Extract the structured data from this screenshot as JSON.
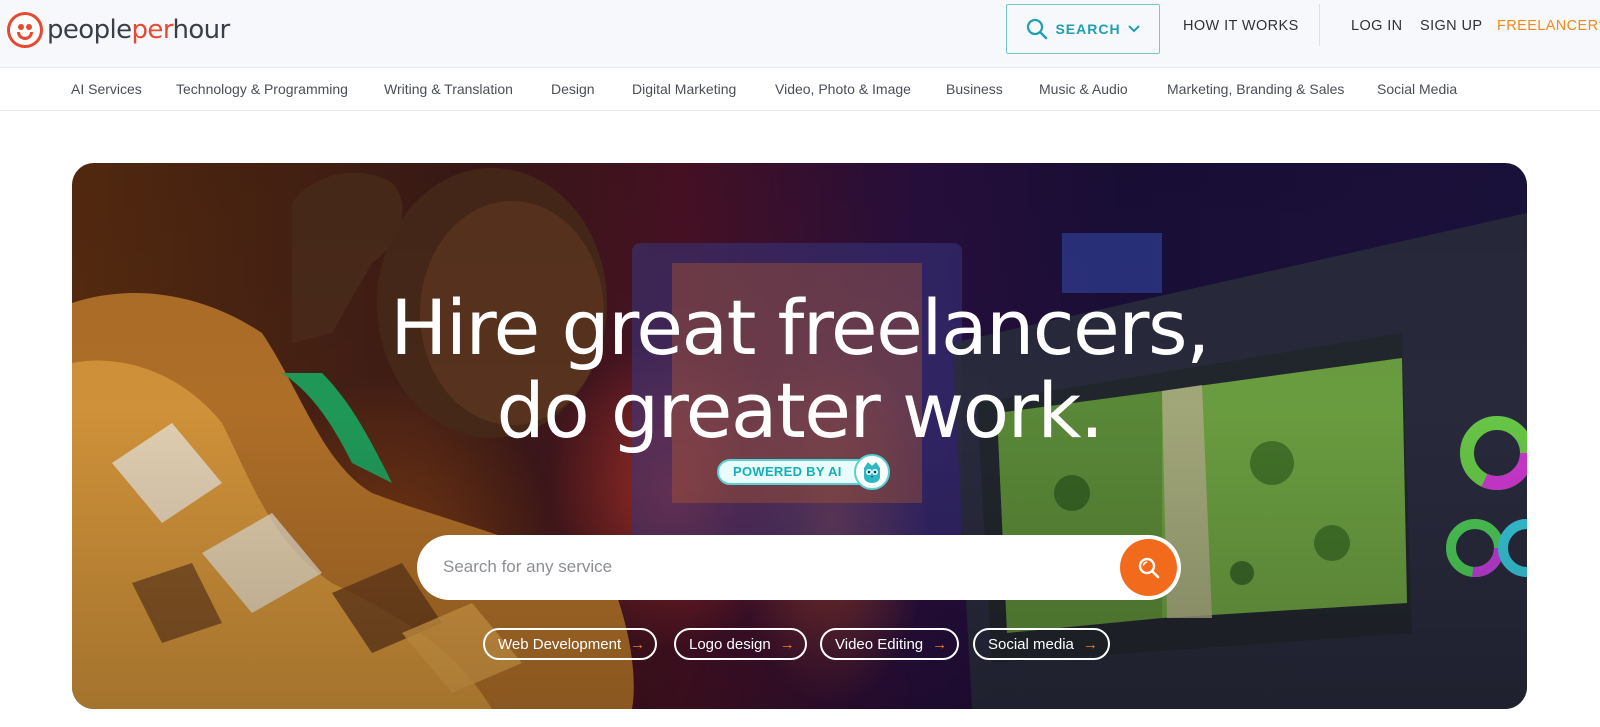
{
  "brand": {
    "people": "people",
    "per": "per",
    "hour": "hour",
    "icon": "smiley-face-logo"
  },
  "header": {
    "search_toggle": {
      "label": "SEARCH",
      "icon": "search-icon",
      "caret": "chevron-down-icon",
      "color": "#1f9fb0"
    },
    "how_it_works": "HOW IT WORKS",
    "log_in": "LOG IN",
    "sign_up": "SIGN UP",
    "freelancer": "FREELANCER?",
    "freelancer_color": "#f08a1d"
  },
  "categories": [
    "AI Services",
    "Technology & Programming",
    "Writing & Translation",
    "Design",
    "Digital Marketing",
    "Video, Photo & Image",
    "Business",
    "Music & Audio",
    "Marketing, Branding & Sales",
    "Social Media"
  ],
  "hero": {
    "headline_line1": "Hire great freelancers,",
    "headline_line2": "do greater work.",
    "ai_badge": "POWERED BY AI",
    "ai_badge_icon": "robot-owl-icon",
    "search_placeholder": "Search for any service",
    "search_button_icon": "search-icon",
    "search_button_color": "#f26b1d",
    "chips": [
      {
        "label": "Web Development",
        "icon": "arrow-right-icon"
      },
      {
        "label": "Logo design",
        "icon": "arrow-right-icon"
      },
      {
        "label": "Video Editing",
        "icon": "arrow-right-icon"
      },
      {
        "label": "Social media",
        "icon": "arrow-right-icon"
      }
    ]
  }
}
